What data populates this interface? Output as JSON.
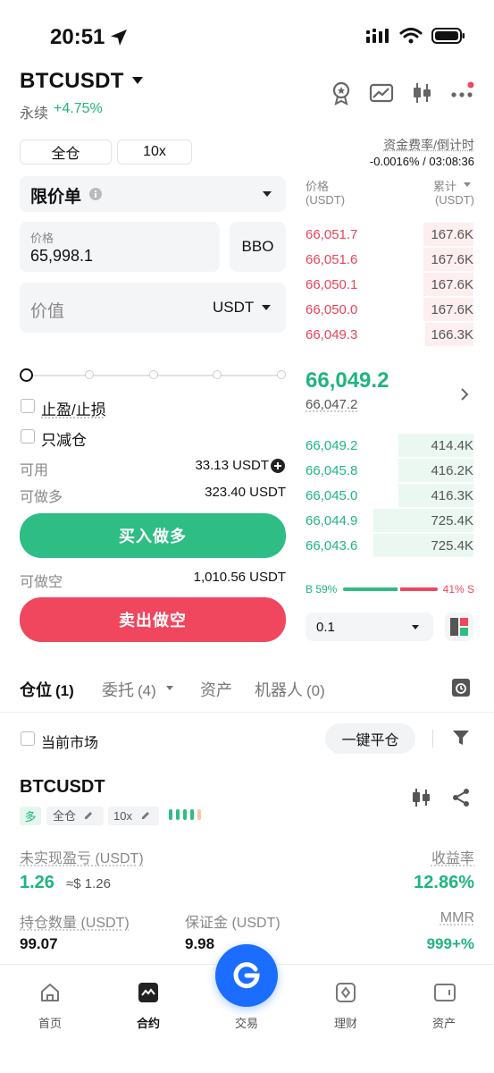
{
  "status_bar": {
    "time": "20:51"
  },
  "header": {
    "symbol": "BTCUSDT",
    "contract_type": "永续",
    "change": "+4.75%"
  },
  "order_form": {
    "margin_mode": "全仓",
    "leverage": "10x",
    "order_type": "限价单",
    "price_label": "价格",
    "price_value": "65,998.1",
    "bbo_label": "BBO",
    "value_placeholder": "价值",
    "value_unit": "USDT",
    "tp_sl_label": "止盈/止损",
    "reduce_only_label": "只减仓",
    "available_label": "可用",
    "available_value": "33.13 USDT",
    "max_long_label": "可做多",
    "max_long_value": "323.40 USDT",
    "buy_label": "买入做多",
    "max_short_label": "可做空",
    "max_short_value": "1,010.56 USDT",
    "sell_label": "卖出做空"
  },
  "funding": {
    "label": "资金费率/倒计时",
    "value": "-0.0016% / 03:08:36"
  },
  "orderbook": {
    "price_header": "价格",
    "price_unit": "(USDT)",
    "cum_header": "累计",
    "cum_unit": "(USDT)",
    "asks": [
      {
        "price": "66,051.7",
        "total": "167.6K"
      },
      {
        "price": "66,051.6",
        "total": "167.6K"
      },
      {
        "price": "66,050.1",
        "total": "167.6K"
      },
      {
        "price": "66,050.0",
        "total": "167.6K"
      },
      {
        "price": "66,049.3",
        "total": "166.3K"
      }
    ],
    "last_price": "66,049.2",
    "mark_price": "66,047.2",
    "bids": [
      {
        "price": "66,049.2",
        "total": "414.4K"
      },
      {
        "price": "66,045.8",
        "total": "416.2K"
      },
      {
        "price": "66,045.0",
        "total": "416.3K"
      },
      {
        "price": "66,044.9",
        "total": "725.4K"
      },
      {
        "price": "66,043.6",
        "total": "725.4K"
      }
    ],
    "buy_ratio_label": "B 59%",
    "sell_ratio_label": "41% S",
    "buy_ratio": 0.59,
    "precision": "0.1"
  },
  "tabs": {
    "positions": "仓位",
    "positions_count": "(1)",
    "orders": "委托",
    "orders_count": "(4)",
    "assets": "资产",
    "bots": "机器人",
    "bots_count": "(0)"
  },
  "filter": {
    "current_market": "当前市场",
    "close_all": "一键平仓"
  },
  "position": {
    "symbol": "BTCUSDT",
    "side": "多",
    "margin_mode": "全仓",
    "leverage": "10x",
    "unrealized_pnl_label": "未实现盈亏 (USDT)",
    "unrealized_pnl": "1.26",
    "unrealized_pnl_usd": "≈$ 1.26",
    "roe_label": "收益率",
    "roe": "12.86%",
    "size_label": "持仓数量 (USDT)",
    "size": "99.07",
    "margin_label": "保证金 (USDT)",
    "margin": "9.98",
    "mmr_label": "MMR",
    "mmr": "999+%"
  },
  "bottom_nav": {
    "home": "首页",
    "futures": "合约",
    "trade": "交易",
    "earn": "理财",
    "assets": "资产"
  },
  "colors": {
    "green": "#2ebd85",
    "red": "#f0465e",
    "bid_green": "#1fb57d",
    "ask_red": "#e9425a",
    "accent_blue": "#1a6dff"
  }
}
